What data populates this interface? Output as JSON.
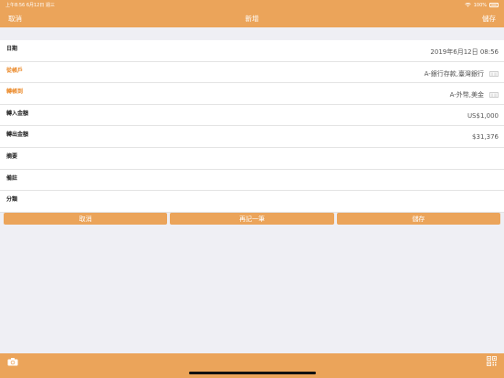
{
  "status": {
    "time_date": "上午8:56   6月12日 週三",
    "battery": "100%"
  },
  "nav": {
    "cancel": "取消",
    "title": "新增",
    "save": "儲存"
  },
  "form": {
    "rows": [
      {
        "label": "日期",
        "value": "2019年6月12日 08:56",
        "accent": false
      },
      {
        "label": "從帳戶",
        "value": "A-銀行存款,臺灣銀行",
        "accent": true
      },
      {
        "label": "轉帳到",
        "value": "A-外幣,美金",
        "accent": true
      },
      {
        "label": "轉入金額",
        "value": "US$1,000",
        "accent": false
      },
      {
        "label": "轉出金額",
        "value": "$31,376",
        "accent": false
      },
      {
        "label": "摘要",
        "value": "",
        "accent": false
      },
      {
        "label": "備註",
        "value": "",
        "accent": false
      },
      {
        "label": "分類",
        "value": "",
        "accent": false
      }
    ],
    "row_icon_text": "|||||"
  },
  "actions": {
    "cancel": "取消",
    "again": "再記一筆",
    "save": "儲存"
  },
  "colors": {
    "accent": "#eba45a",
    "label_accent": "#eb8a2a"
  },
  "icons": {
    "camera": "camera-icon",
    "qr": "qr-code-icon",
    "wifi": "wifi-icon",
    "battery": "battery-icon"
  }
}
